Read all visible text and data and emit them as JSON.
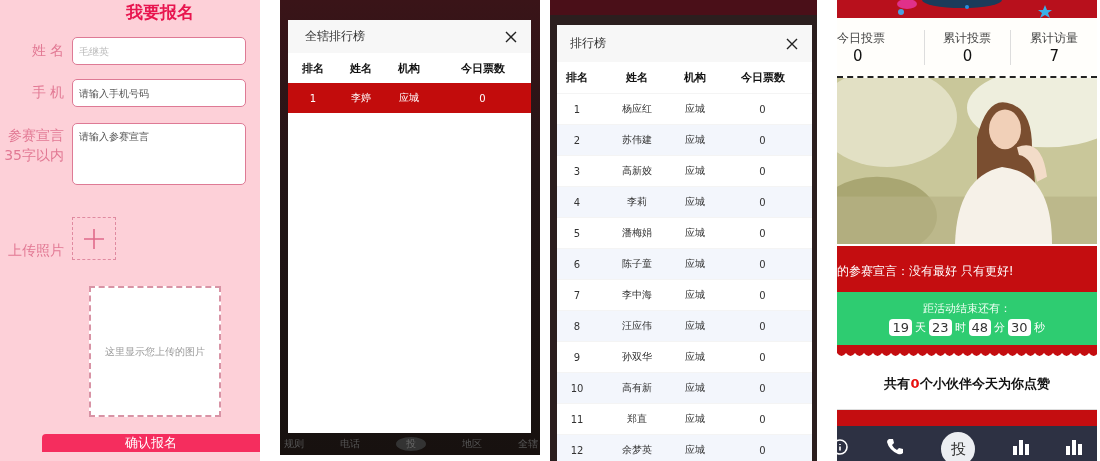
{
  "signup": {
    "title": "我要报名",
    "fields": [
      {
        "kind": "input",
        "label": "姓 名",
        "placeholder": "毛继英",
        "pale": true
      },
      {
        "kind": "input",
        "label": "手 机",
        "placeholder": "请输入手机号码"
      },
      {
        "kind": "textarea",
        "label": "参赛宣言",
        "sublabel": "35字以内",
        "placeholder": "请输入参赛宣言"
      }
    ],
    "upload_label": "上传照片",
    "preview_text": "这里显示您上传的图片",
    "submit": "确认报名"
  },
  "district_ranking": {
    "title": "全辖排行榜",
    "columns": [
      "排名",
      "姓名",
      "机构",
      "今日票数"
    ],
    "rows": [
      {
        "rank": "1",
        "name": "李婷",
        "org": "应城",
        "votes": "0",
        "selected": true
      }
    ]
  },
  "background_nav": [
    "规则",
    "电话",
    "投",
    "地区",
    "全辖"
  ],
  "ranking": {
    "title": "排行榜",
    "columns": [
      "排名",
      "姓名",
      "机构",
      "今日票数"
    ],
    "rows": [
      {
        "rank": "1",
        "name": "杨应红",
        "org": "应城",
        "votes": "0",
        "selected": false
      },
      {
        "rank": "2",
        "name": "苏伟建",
        "org": "应城",
        "votes": "0",
        "selected": false
      },
      {
        "rank": "3",
        "name": "高新姣",
        "org": "应城",
        "votes": "0",
        "selected": false
      },
      {
        "rank": "4",
        "name": "李莉",
        "org": "应城",
        "votes": "0",
        "selected": false
      },
      {
        "rank": "5",
        "name": "潘梅娟",
        "org": "应城",
        "votes": "0",
        "selected": false
      },
      {
        "rank": "6",
        "name": "陈子童",
        "org": "应城",
        "votes": "0",
        "selected": false
      },
      {
        "rank": "7",
        "name": "李中海",
        "org": "应城",
        "votes": "0",
        "selected": false
      },
      {
        "rank": "8",
        "name": "汪应伟",
        "org": "应城",
        "votes": "0",
        "selected": false
      },
      {
        "rank": "9",
        "name": "孙双华",
        "org": "应城",
        "votes": "0",
        "selected": false
      },
      {
        "rank": "10",
        "name": "高有新",
        "org": "应城",
        "votes": "0",
        "selected": false
      },
      {
        "rank": "11",
        "name": "郑直",
        "org": "应城",
        "votes": "0",
        "selected": false
      },
      {
        "rank": "12",
        "name": "余梦英",
        "org": "应城",
        "votes": "0",
        "selected": false
      }
    ]
  },
  "contestant": {
    "stats": [
      {
        "label": "今日投票",
        "value": "0"
      },
      {
        "label": "累计投票",
        "value": "0"
      },
      {
        "label": "累计访量",
        "value": "7"
      }
    ],
    "slogan": "的参赛宣言：没有最好 只有更好!",
    "countdown": {
      "label": "距活动结束还有：",
      "units": [
        {
          "value": "19",
          "unit": "天"
        },
        {
          "value": "23",
          "unit": "时"
        },
        {
          "value": "48",
          "unit": "分"
        },
        {
          "value": "30",
          "unit": "秒"
        }
      ]
    },
    "likes": {
      "prefix": "共有",
      "count": "0",
      "suffix": "个小伙伴今天为你点赞"
    },
    "nav": [
      {
        "kind": "info"
      },
      {
        "kind": "phone"
      },
      {
        "kind": "vote",
        "label": "投"
      },
      {
        "kind": "chart"
      },
      {
        "kind": "chart"
      }
    ]
  }
}
